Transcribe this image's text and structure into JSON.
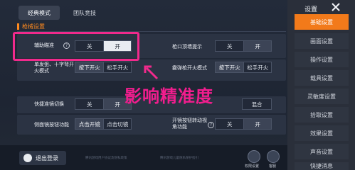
{
  "tabs": [
    {
      "label": "经典模式",
      "active": true
    },
    {
      "label": "团队竞技",
      "active": false
    }
  ],
  "section": {
    "title": "枪械设置"
  },
  "settings": {
    "aim_assist": {
      "label": "辅助瞄准",
      "off": "关",
      "on": "开",
      "selected": "开"
    },
    "scope_hint": {
      "label": "枪口顶墙提示",
      "off": "关",
      "on": "开",
      "selected": "开"
    },
    "single_fire": {
      "label": "单发狙、十字弩开火模式",
      "opt1": "按下开火",
      "opt2": "松手开火"
    },
    "burst_fire": {
      "label": "霰弹枪开火模式",
      "opt1": "按下开火",
      "opt2": "松手开火"
    },
    "quick_scope": {
      "label": "快捷准镜切换",
      "off": "关",
      "on": "开",
      "selected": "开"
    },
    "hidden_row": {
      "opt3": "混合"
    },
    "side_scope": {
      "label": "侧面镜按钮功能",
      "opt1": "点击开镜",
      "opt2": "点击切镜"
    },
    "open_scope": {
      "label": "开镜按钮转动视角功能",
      "off": "关",
      "on": "开",
      "selected": "开"
    }
  },
  "annotation": {
    "text": "影响精准度",
    "color": "#f21d8e"
  },
  "bottom": {
    "logout_label": "退出登录",
    "faint_left": "腾讯游戏用户协议及隐私政策",
    "faint_right": "腾讯游戏儿童隐私保护指引",
    "icon1_label": "权限设置",
    "icon2_label": "客服"
  },
  "sidebar": {
    "title": "设置",
    "items": [
      {
        "label": "基础设置",
        "active": true
      },
      {
        "label": "画面设置",
        "active": false
      },
      {
        "label": "操作设置",
        "active": false
      },
      {
        "label": "载具设置",
        "active": false
      },
      {
        "label": "灵敏度设置",
        "active": false
      },
      {
        "label": "拾取设置",
        "active": false
      },
      {
        "label": "效果设置",
        "active": false
      },
      {
        "label": "声音设置",
        "active": false
      },
      {
        "label": "快捷消息",
        "active": false
      }
    ]
  },
  "colors": {
    "accent": "#f27a1a",
    "highlight": "#f12a8c"
  }
}
